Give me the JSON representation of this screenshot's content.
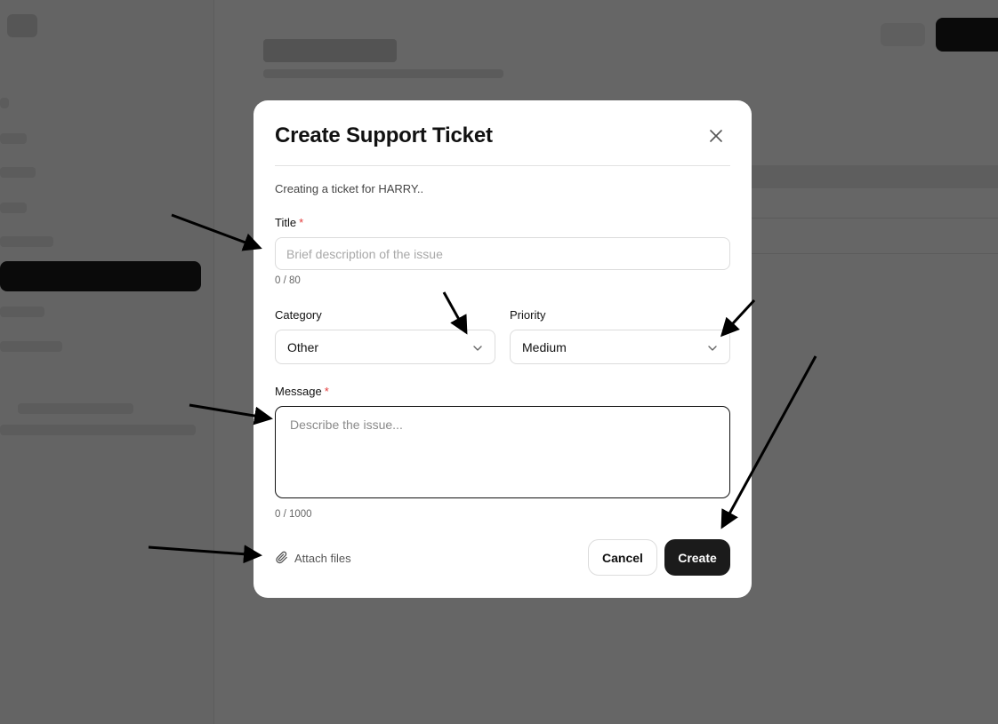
{
  "modal": {
    "title": "Create Support Ticket",
    "intro": "Creating a ticket for HARRY..",
    "required_mark": "*",
    "title_field": {
      "label": "Title",
      "placeholder": "Brief description of the issue",
      "value": "",
      "counter": "0 / 80"
    },
    "category": {
      "label": "Category",
      "value": "Other"
    },
    "priority": {
      "label": "Priority",
      "value": "Medium"
    },
    "message_field": {
      "label": "Message",
      "placeholder": "Describe the issue...",
      "value": "",
      "counter": "0 / 1000"
    },
    "attach_label": "Attach files",
    "cancel_label": "Cancel",
    "create_label": "Create"
  },
  "icons": {
    "close": "close-icon",
    "chevron": "chevron-down-icon",
    "attach": "paperclip-icon"
  },
  "colors": {
    "required": "#e23b3b",
    "primary_button": "#1b1b1b",
    "overlay": "rgba(0,0,0,0.6)"
  }
}
